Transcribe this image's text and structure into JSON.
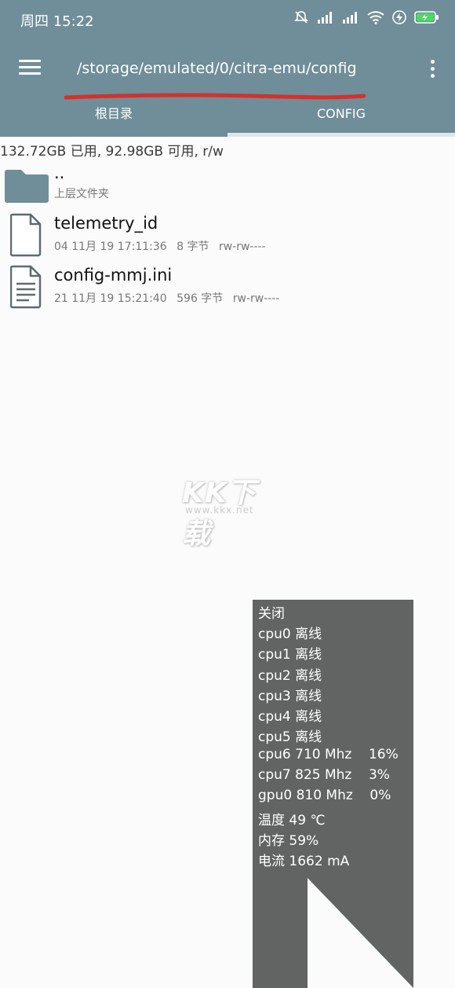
{
  "status_bar": {
    "time": "周四 15:22",
    "icons": [
      "mute-icon",
      "signal-icon",
      "signal-icon",
      "wifi-icon",
      "flash-icon",
      "battery-charging-icon"
    ]
  },
  "toolbar": {
    "path": "/storage/emulated/0/citra-emu/config",
    "menu_icon": "hamburger-menu-icon",
    "overflow_icon": "more-vert-icon"
  },
  "tabs": [
    {
      "label": "根目录",
      "active": false
    },
    {
      "label": "CONFIG",
      "active": true
    }
  ],
  "storage_info": "132.72GB 已用, 92.98GB 可用, r/w",
  "files": [
    {
      "icon": "folder-icon",
      "name": "..",
      "subtitle": "上层文件夹"
    },
    {
      "icon": "file-icon",
      "name": "telemetry_id",
      "date": "04 11月 19 17:11:36",
      "size": "8 字节",
      "perms": "rw-rw----"
    },
    {
      "icon": "text-file-icon",
      "name": "config-mmj.ini",
      "date": "21 11月 19 15:21:40",
      "size": "596 字节",
      "perms": "rw-rw----"
    }
  ],
  "watermark": {
    "title": "KK下载",
    "url": "www.kkx.net"
  },
  "overlay": {
    "lines": [
      "关闭",
      "cpu0 离线",
      "cpu1 离线",
      "cpu2 离线",
      "cpu3 离线",
      "cpu4 离线",
      "cpu5 离线",
      "cpu6 710 Mhz    16%",
      "cpu7 825 Mhz    3%",
      "gpu0 810 Mhz    0%",
      "温度 49 ℃",
      "内存 59%",
      "电流 1662 mA"
    ]
  },
  "colors": {
    "appbar": "#6f8e99",
    "annotation_red": "#d6302a",
    "overlay_bg": "#616462",
    "folder": "#6f8e99"
  }
}
